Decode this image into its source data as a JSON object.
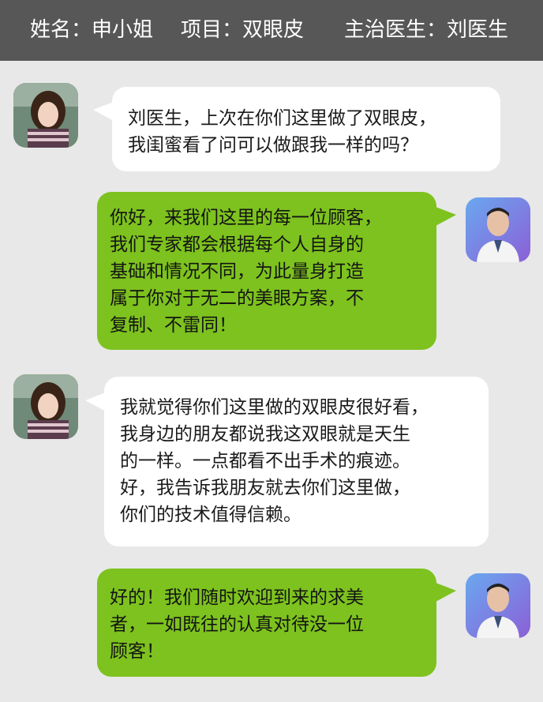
{
  "header": {
    "name": "姓名：申小姐",
    "project": "项目：双眼皮",
    "doctor": "主治医生：刘医生"
  },
  "messages": [
    {
      "sender": "patient",
      "lines": [
        "刘医生，上次在你们这里做了双眼皮，",
        "我闺蜜看了问可以做跟我一样的吗？"
      ]
    },
    {
      "sender": "doctor",
      "lines": [
        "你好，来我们这里的每一位顾客，",
        "我们专家都会根据每个人自身的",
        "基础和情况不同，为此量身打造",
        "属于你对于无二的美眼方案，不",
        "复制、不雷同！"
      ]
    },
    {
      "sender": "patient",
      "lines": [
        "我就觉得你们这里做的双眼皮很好看，",
        "我身边的朋友都说我这双眼就是天生",
        "的一样。一点都看不出手术的痕迹。",
        "好，我告诉我朋友就去你们这里做，",
        "你们的技术值得信赖。"
      ]
    },
    {
      "sender": "doctor",
      "lines": [
        "好的！我们随时欢迎到来的求美",
        "者，一如既往的认真对待没一位",
        "顾客！"
      ]
    }
  ],
  "colors": {
    "header_bg": "#575757",
    "page_bg": "#e8e8e8",
    "patient_bubble": "#ffffff",
    "doctor_bubble": "#7dc21e"
  }
}
